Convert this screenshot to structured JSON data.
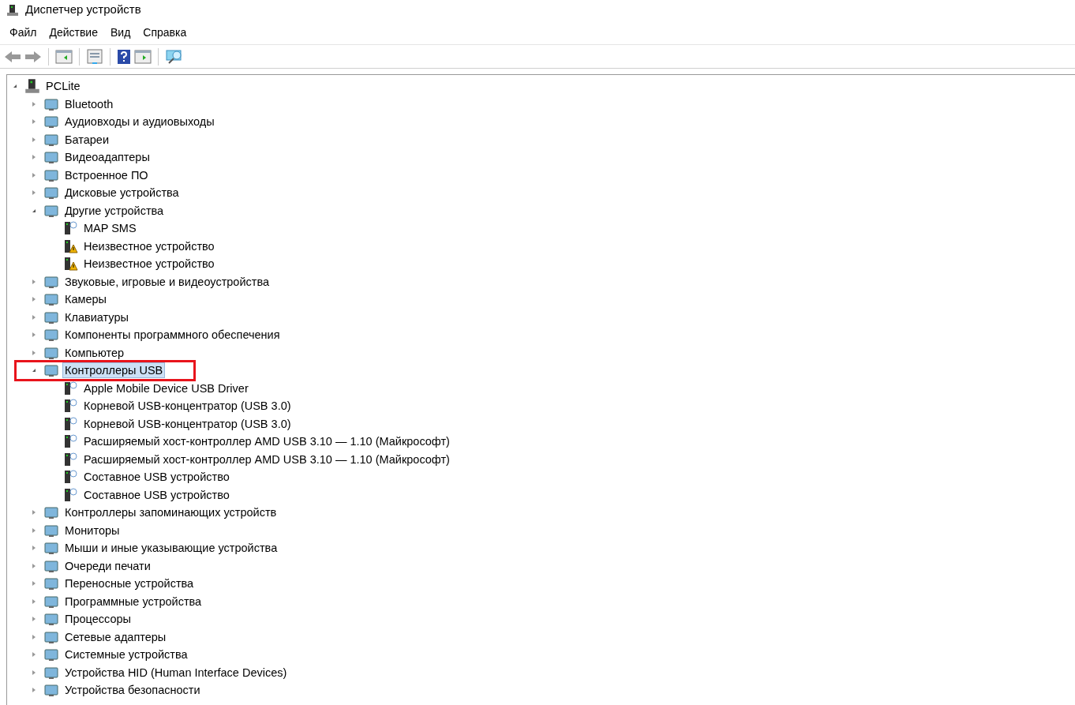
{
  "window": {
    "title": "Диспетчер устройств"
  },
  "menu": [
    "Файл",
    "Действие",
    "Вид",
    "Справка"
  ],
  "tree": {
    "label": "PCLite",
    "expanded": true,
    "children": [
      {
        "label": "Bluetooth",
        "expanded": false,
        "selected": false
      },
      {
        "label": "Аудиовходы и аудиовыходы",
        "expanded": false,
        "selected": false
      },
      {
        "label": "Батареи",
        "expanded": false,
        "selected": false
      },
      {
        "label": "Видеоадаптеры",
        "expanded": false,
        "selected": false
      },
      {
        "label": "Встроенное ПО",
        "expanded": false,
        "selected": false
      },
      {
        "label": "Дисковые устройства",
        "expanded": false,
        "selected": false
      },
      {
        "label": "Другие устройства",
        "expanded": true,
        "selected": false,
        "children": [
          {
            "label": "MAP SMS",
            "warning": false
          },
          {
            "label": "Неизвестное устройство",
            "warning": true
          },
          {
            "label": "Неизвестное устройство",
            "warning": true
          }
        ]
      },
      {
        "label": "Звуковые, игровые и видеоустройства",
        "expanded": false,
        "selected": false
      },
      {
        "label": "Камеры",
        "expanded": false,
        "selected": false
      },
      {
        "label": "Клавиатуры",
        "expanded": false,
        "selected": false
      },
      {
        "label": "Компоненты программного обеспечения",
        "expanded": false,
        "selected": false
      },
      {
        "label": "Компьютер",
        "expanded": false,
        "selected": false
      },
      {
        "label": "Контроллеры USB",
        "expanded": true,
        "selected": true,
        "children": [
          {
            "label": "Apple Mobile Device USB Driver",
            "warning": false
          },
          {
            "label": "Корневой USB-концентратор (USB 3.0)",
            "warning": false
          },
          {
            "label": "Корневой USB-концентратор (USB 3.0)",
            "warning": false
          },
          {
            "label": "Расширяемый хост-контроллер AMD USB 3.10 — 1.10 (Майкрософт)",
            "warning": false
          },
          {
            "label": "Расширяемый хост-контроллер AMD USB 3.10 — 1.10 (Майкрософт)",
            "warning": false
          },
          {
            "label": "Составное USB устройство",
            "warning": false
          },
          {
            "label": "Составное USB устройство",
            "warning": false
          }
        ]
      },
      {
        "label": "Контроллеры запоминающих устройств",
        "expanded": false,
        "selected": false
      },
      {
        "label": "Мониторы",
        "expanded": false,
        "selected": false
      },
      {
        "label": "Мыши и иные указывающие устройства",
        "expanded": false,
        "selected": false
      },
      {
        "label": "Очереди печати",
        "expanded": false,
        "selected": false
      },
      {
        "label": "Переносные устройства",
        "expanded": false,
        "selected": false
      },
      {
        "label": "Программные устройства",
        "expanded": false,
        "selected": false
      },
      {
        "label": "Процессоры",
        "expanded": false,
        "selected": false
      },
      {
        "label": "Сетевые адаптеры",
        "expanded": false,
        "selected": false
      },
      {
        "label": "Системные устройства",
        "expanded": false,
        "selected": false
      },
      {
        "label": "Устройства HID (Human Interface Devices)",
        "expanded": false,
        "selected": false
      },
      {
        "label": "Устройства безопасности",
        "expanded": false,
        "selected": false
      }
    ]
  }
}
